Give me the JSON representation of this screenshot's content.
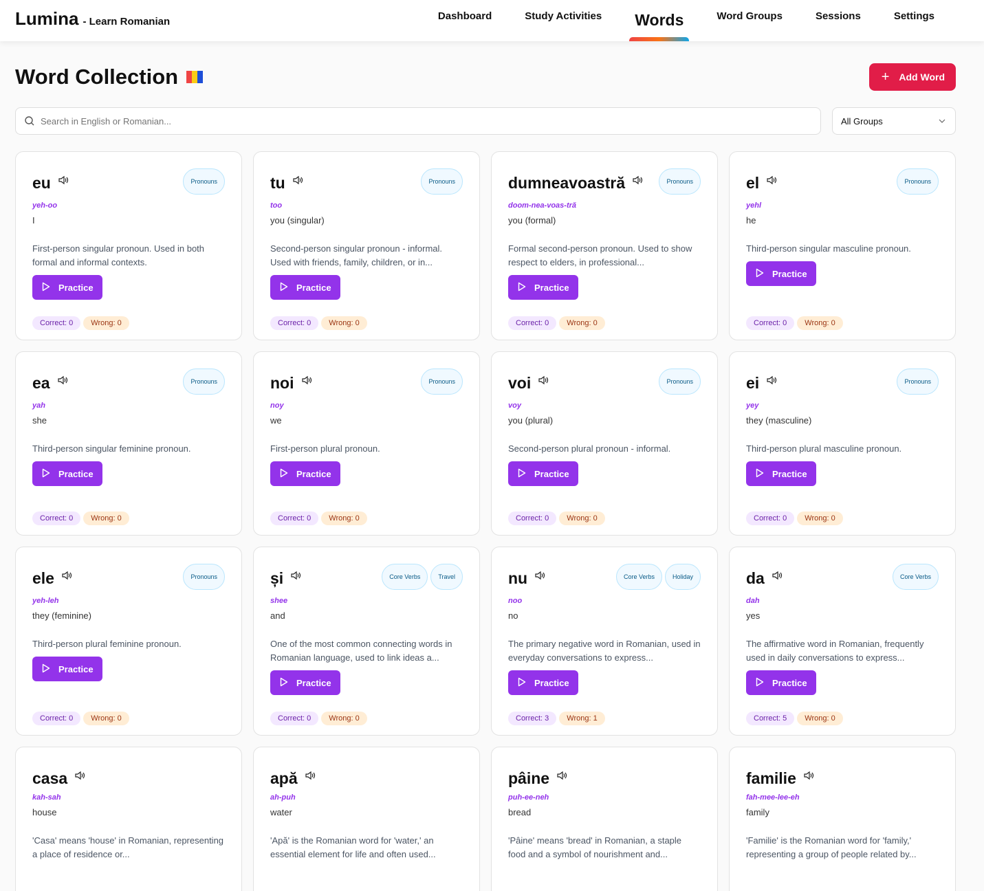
{
  "nav": {
    "brand": "Lumina",
    "subtitle": "- Learn Romanian",
    "links": [
      "Dashboard",
      "Study Activities",
      "Words",
      "Word Groups",
      "Sessions",
      "Settings"
    ],
    "active": "Words"
  },
  "header": {
    "title": "Word Collection",
    "add_label": "Add Word",
    "flag_colors": [
      "#ef4444",
      "#facc15",
      "#1d4ed8"
    ]
  },
  "filters": {
    "search_placeholder": "Search in English or Romanian...",
    "group_selected": "All Groups"
  },
  "practice_label": "Practice",
  "words": [
    {
      "word": "eu",
      "pron": "yeh-oo",
      "meaning": "I",
      "desc": "First-person singular pronoun. Used in both formal and informal contexts.",
      "tags": [
        "Pronouns"
      ],
      "correct": "Correct: 0",
      "wrong": "Wrong: 0"
    },
    {
      "word": "tu",
      "pron": "too",
      "meaning": "you (singular)",
      "desc": "Second-person singular pronoun - informal. Used with friends, family, children, or in...",
      "tags": [
        "Pronouns"
      ],
      "correct": "Correct: 0",
      "wrong": "Wrong: 0"
    },
    {
      "word": "dumneavoastră",
      "pron": "doom-nea-voas-tră",
      "meaning": "you (formal)",
      "desc": "Formal second-person pronoun. Used to show respect to elders, in professional...",
      "tags": [
        "Pronouns"
      ],
      "correct": "Correct: 0",
      "wrong": "Wrong: 0"
    },
    {
      "word": "el",
      "pron": "yehl",
      "meaning": "he",
      "desc": "Third-person singular masculine pronoun.",
      "tags": [
        "Pronouns"
      ],
      "correct": "Correct: 0",
      "wrong": "Wrong: 0"
    },
    {
      "word": "ea",
      "pron": "yah",
      "meaning": "she",
      "desc": "Third-person singular feminine pronoun.",
      "tags": [
        "Pronouns"
      ],
      "correct": "Correct: 0",
      "wrong": "Wrong: 0"
    },
    {
      "word": "noi",
      "pron": "noy",
      "meaning": "we",
      "desc": "First-person plural pronoun.",
      "tags": [
        "Pronouns"
      ],
      "correct": "Correct: 0",
      "wrong": "Wrong: 0"
    },
    {
      "word": "voi",
      "pron": "voy",
      "meaning": "you (plural)",
      "desc": "Second-person plural pronoun - informal.",
      "tags": [
        "Pronouns"
      ],
      "correct": "Correct: 0",
      "wrong": "Wrong: 0"
    },
    {
      "word": "ei",
      "pron": "yey",
      "meaning": "they (masculine)",
      "desc": "Third-person plural masculine pronoun.",
      "tags": [
        "Pronouns"
      ],
      "correct": "Correct: 0",
      "wrong": "Wrong: 0"
    },
    {
      "word": "ele",
      "pron": "yeh-leh",
      "meaning": "they (feminine)",
      "desc": "Third-person plural feminine pronoun.",
      "tags": [
        "Pronouns"
      ],
      "correct": "Correct: 0",
      "wrong": "Wrong: 0"
    },
    {
      "word": "și",
      "pron": "shee",
      "meaning": "and",
      "desc": "One of the most common connecting words in Romanian language, used to link ideas a...",
      "tags": [
        "Core Verbs",
        "Travel"
      ],
      "correct": "Correct: 0",
      "wrong": "Wrong: 0"
    },
    {
      "word": "nu",
      "pron": "noo",
      "meaning": "no",
      "desc": "The primary negative word in Romanian, used in everyday conversations to express...",
      "tags": [
        "Core Verbs",
        "Holiday"
      ],
      "correct": "Correct: 3",
      "wrong": "Wrong: 1"
    },
    {
      "word": "da",
      "pron": "dah",
      "meaning": "yes",
      "desc": "The affirmative word in Romanian, frequently used in daily conversations to express...",
      "tags": [
        "Core Verbs"
      ],
      "correct": "Correct: 5",
      "wrong": "Wrong: 0"
    },
    {
      "word": "casa",
      "pron": "kah-sah",
      "meaning": "house",
      "desc": "'Casa' means 'house' in Romanian, representing a place of residence or...",
      "tags": [],
      "correct": null,
      "wrong": null
    },
    {
      "word": "apă",
      "pron": "ah-puh",
      "meaning": "water",
      "desc": "'Apă' is the Romanian word for 'water,' an essential element for life and often used...",
      "tags": [],
      "correct": null,
      "wrong": null
    },
    {
      "word": "pâine",
      "pron": "puh-ee-neh",
      "meaning": "bread",
      "desc": "'Pâine' means 'bread' in Romanian, a staple food and a symbol of nourishment and...",
      "tags": [],
      "correct": null,
      "wrong": null
    },
    {
      "word": "familie",
      "pron": "fah-mee-lee-eh",
      "meaning": "family",
      "desc": "'Familie' is the Romanian word for 'family,' representing a group of people related by...",
      "tags": [],
      "correct": null,
      "wrong": null
    }
  ]
}
